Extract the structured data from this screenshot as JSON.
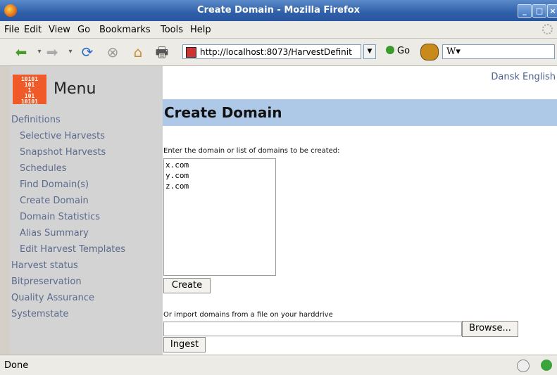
{
  "window": {
    "title": "Create Domain - Mozilla Firefox"
  },
  "menubar": {
    "items": [
      {
        "label": "File"
      },
      {
        "label": "Edit"
      },
      {
        "label": "View"
      },
      {
        "label": "Go"
      },
      {
        "label": "Bookmarks"
      },
      {
        "label": "Tools"
      },
      {
        "label": "Help"
      }
    ]
  },
  "toolbar": {
    "url": "http://localhost:8073/HarvestDefinit",
    "go_label": "Go",
    "search_placeholder": "W"
  },
  "sidebar": {
    "logo_text": "10101\n101\n1\n101\n10101",
    "title": "Menu",
    "items": [
      {
        "label": "Definitions",
        "level": "top"
      },
      {
        "label": "Selective Harvests",
        "level": "sub"
      },
      {
        "label": "Snapshot Harvests",
        "level": "sub"
      },
      {
        "label": "Schedules",
        "level": "sub"
      },
      {
        "label": "Find Domain(s)",
        "level": "sub"
      },
      {
        "label": "Create Domain",
        "level": "sub"
      },
      {
        "label": "Domain Statistics",
        "level": "sub"
      },
      {
        "label": "Alias Summary",
        "level": "sub"
      },
      {
        "label": "Edit Harvest Templates",
        "level": "sub"
      },
      {
        "label": "Harvest status",
        "level": "top"
      },
      {
        "label": "Bitpreservation",
        "level": "top"
      },
      {
        "label": "Quality Assurance",
        "level": "top"
      },
      {
        "label": "Systemstate",
        "level": "top"
      }
    ]
  },
  "languages": "Dansk English",
  "main": {
    "heading": "Create Domain",
    "domains_label": "Enter the domain or list of domains to be created:",
    "domains_value": "x.com\ny.com\nz.com",
    "create_label": "Create",
    "import_label": "Or import domains from a file on your harddrive",
    "browse_label": "Browse...",
    "ingest_label": "Ingest"
  },
  "statusbar": {
    "text": "Done"
  },
  "colors": {
    "titlebar": "#2f5fa8",
    "heading_bg": "#aec9e8",
    "sidebar_bg": "#d3d3d3",
    "link": "#5b6b8c",
    "logo": "#f05a28"
  }
}
